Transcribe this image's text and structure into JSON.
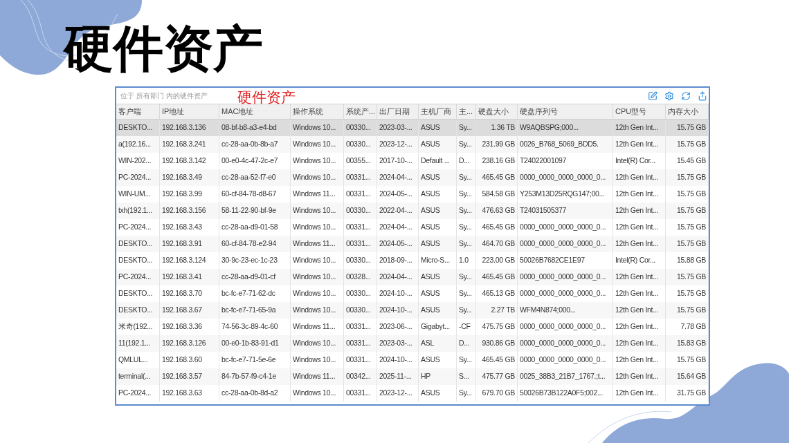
{
  "slide_title": "硬件资产",
  "window": {
    "breadcrumb": "位于 所有部门 内的硬件资产",
    "overlay_title": "硬件资产"
  },
  "table": {
    "columns": [
      "客户端",
      "IP地址",
      "MAC地址",
      "操作系统",
      "系统产...",
      "出厂日期",
      "主机厂商",
      "主...",
      "硬盘大小",
      "硬盘序列号",
      "CPU型号",
      "内存大小"
    ],
    "rows": [
      {
        "selected": true,
        "cells": [
          "DESKTO...",
          "192.168.3.136",
          "08-bf-b8-a3-e4-bd",
          "Windows 10...",
          "00330...",
          "2023-03-...",
          "ASUS",
          "Sy...",
          "1.36 TB",
          "W9AQBSPG;000...",
          "12th Gen Int...",
          "15.75 GB"
        ]
      },
      {
        "selected": false,
        "cells": [
          "a(192.16...",
          "192.168.3.241",
          "cc-28-aa-0b-8b-a7",
          "Windows 10...",
          "00330...",
          "2023-12-...",
          "ASUS",
          "Sy...",
          "231.99 GB",
          "0026_B768_5069_BDD5.",
          "12th Gen Int...",
          "15.75 GB"
        ]
      },
      {
        "selected": false,
        "cells": [
          "WIN-202...",
          "192.168.3.142",
          "00-e0-4c-47-2c-e7",
          "Windows 10...",
          "00355...",
          "2017-10-...",
          "Default ...",
          "D...",
          "238.16 GB",
          "T24022001097",
          "Intel(R) Cor...",
          "15.45 GB"
        ]
      },
      {
        "selected": false,
        "cells": [
          "PC-2024...",
          "192.168.3.49",
          "cc-28-aa-52-f7-e0",
          "Windows 10...",
          "00331...",
          "2024-04-...",
          "ASUS",
          "Sy...",
          "465.45 GB",
          "0000_0000_0000_0000_0...",
          "12th Gen Int...",
          "15.75 GB"
        ]
      },
      {
        "selected": false,
        "cells": [
          "WIN-UM...",
          "192.168.3.99",
          "60-cf-84-78-d8-67",
          "Windows 11...",
          "00331...",
          "2024-05-...",
          "ASUS",
          "Sy...",
          "584.58 GB",
          "Y253M13D25RQG147;00...",
          "12th Gen Int...",
          "15.75 GB"
        ]
      },
      {
        "selected": false,
        "cells": [
          "txh(192.1...",
          "192.168.3.156",
          "58-11-22-90-bf-9e",
          "Windows 10...",
          "00330...",
          "2022-04-...",
          "ASUS",
          "Sy...",
          "476.63 GB",
          "T24031505377",
          "12th Gen Int...",
          "15.75 GB"
        ]
      },
      {
        "selected": false,
        "cells": [
          "PC-2024...",
          "192.168.3.43",
          "cc-28-aa-d9-01-58",
          "Windows 10...",
          "00331...",
          "2024-04-...",
          "ASUS",
          "Sy...",
          "465.45 GB",
          "0000_0000_0000_0000_0...",
          "12th Gen Int...",
          "15.75 GB"
        ]
      },
      {
        "selected": false,
        "cells": [
          "DESKTO...",
          "192.168.3.91",
          "60-cf-84-78-e2-94",
          "Windows 11...",
          "00331...",
          "2024-05-...",
          "ASUS",
          "Sy...",
          "464.70 GB",
          "0000_0000_0000_0000_0...",
          "12th Gen Int...",
          "15.75 GB"
        ]
      },
      {
        "selected": false,
        "cells": [
          "DESKTO...",
          "192.168.3.124",
          "30-9c-23-ec-1c-23",
          "Windows 10...",
          "00330...",
          "2018-09-...",
          "Micro-S...",
          "1.0",
          "223.00 GB",
          "50026B7682CE1E97",
          "Intel(R) Cor...",
          "15.88 GB"
        ]
      },
      {
        "selected": false,
        "cells": [
          "PC-2024...",
          "192.168.3.41",
          "cc-28-aa-d9-01-cf",
          "Windows 10...",
          "00328...",
          "2024-04-...",
          "ASUS",
          "Sy...",
          "465.45 GB",
          "0000_0000_0000_0000_0...",
          "12th Gen Int...",
          "15.75 GB"
        ]
      },
      {
        "selected": false,
        "cells": [
          "DESKTO...",
          "192.168.3.70",
          "bc-fc-e7-71-62-dc",
          "Windows 10...",
          "00330...",
          "2024-10-...",
          "ASUS",
          "Sy...",
          "465.13 GB",
          "0000_0000_0000_0000_0...",
          "12th Gen Int...",
          "15.75 GB"
        ]
      },
      {
        "selected": false,
        "cells": [
          "DESKTO...",
          "192.168.3.67",
          "bc-fc-e7-71-65-9a",
          "Windows 10...",
          "00330...",
          "2024-10-...",
          "ASUS",
          "Sy...",
          "2.27 TB",
          "WFM4N874;000...",
          "12th Gen Int...",
          "15.75 GB"
        ]
      },
      {
        "selected": false,
        "cells": [
          "米奇(192...",
          "192.168.3.36",
          "74-56-3c-89-4c-60",
          "Windows 11...",
          "00331...",
          "2023-06-...",
          "Gigabyt...",
          "-CF",
          "475.75 GB",
          "0000_0000_0000_0000_0...",
          "12th Gen Int...",
          "7.78 GB"
        ]
      },
      {
        "selected": false,
        "cells": [
          "11(192.1...",
          "192.168.3.126",
          "00-e0-1b-83-91-d1",
          "Windows 10...",
          "00331...",
          "2023-03-...",
          "ASL",
          "D...",
          "930.86 GB",
          "0000_0000_0000_0000_0...",
          "12th Gen Int...",
          "15.83 GB"
        ]
      },
      {
        "selected": false,
        "cells": [
          "QMLUL...",
          "192.168.3.60",
          "bc-fc-e7-71-5e-6e",
          "Windows 10...",
          "00331...",
          "2024-10-...",
          "ASUS",
          "Sy...",
          "465.45 GB",
          "0000_0000_0000_0000_0...",
          "12th Gen Int...",
          "15.75 GB"
        ]
      },
      {
        "selected": false,
        "cells": [
          "terminal(...",
          "192.168.3.57",
          "84-7b-57-f9-c4-1e",
          "Windows 11...",
          "00342...",
          "2025-11-...",
          "HP",
          "S...",
          "475.77 GB",
          "0025_38B3_21B7_1767.;t...",
          "12th Gen Int...",
          "15.64 GB"
        ]
      },
      {
        "selected": false,
        "cells": [
          "PC-2024...",
          "192.168.3.63",
          "cc-28-aa-0b-8d-a2",
          "Windows 10...",
          "00331...",
          "2023-12-...",
          "ASUS",
          "Sy...",
          "679.70 GB",
          "50026B73B122A0F5;002...",
          "12th Gen Int...",
          "31.75 GB"
        ]
      }
    ]
  }
}
